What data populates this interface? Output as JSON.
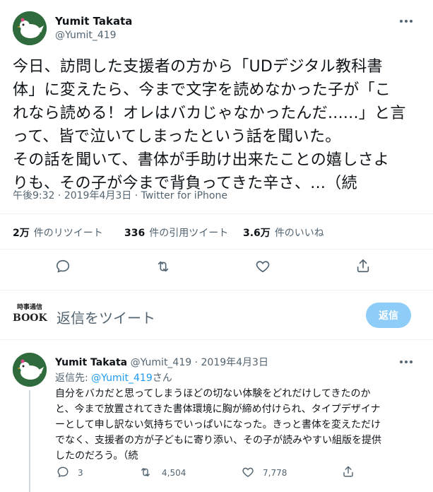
{
  "main_tweet": {
    "display_name": "Yumit Takata",
    "handle": "@Yumit_419",
    "text": "今日、訪問した支援者の方から「UDデジタル教科書\n体」に変えたら、今まで文字を読めなかった子が「こ\nれなら読める！オレはバカじゃなかったんだ......」と言\nって、皆で泣いてしまったという話を聞いた。\nその話を聞いて、書体が手助け出来たことの嬉しさよ\nりも、その子が今まで背負ってきた辛さ、...（続",
    "time": "午後9:32",
    "date": "2019年4月3日",
    "source": "Twitter for iPhone",
    "meta_sep": " · "
  },
  "stats": {
    "retweets_num": "2万",
    "retweets_label": "件のリツイート",
    "quotes_num": "336",
    "quotes_label": "件の引用ツイート",
    "likes_num": "3.6万",
    "likes_label": "件のいいね"
  },
  "icons": {
    "reply": "comment-icon",
    "retweet": "retweet-icon",
    "like": "heart-icon",
    "share": "share-icon",
    "more": "more-dots-icon"
  },
  "reply_box": {
    "logo_top": "時事通信",
    "logo_bottom": "BOOK",
    "placeholder": "返信をツイート",
    "button_label": "返信"
  },
  "reply_tweet": {
    "display_name": "Yumit Takata",
    "handle": "@Yumit_419",
    "date": "2019年4月3日",
    "reply_prefix": "返信先: ",
    "reply_target": "@Yumit_419",
    "reply_suffix": "さん",
    "text": "自分をバカだと思ってしまうほどの切ない体験をどれだけしてきたのか\nと、今まで放置されてきた書体環境に胸が締め付けられ、タイプデザイナ\nーとして申し訳ない気持ちでいっぱいになった。きっと書体を変えただけ\nでなく、支援者の方が子どもに寄り添い、その子が読みやすい組版を提供\nしたのだろう。（続",
    "replies": "3",
    "retweets": "4,504",
    "likes": "7,778"
  },
  "colors": {
    "accent": "#1d9bf0",
    "reply_button": "#8ecdf8",
    "avatar_bg": "#2f6b3c",
    "muted": "#536471"
  }
}
